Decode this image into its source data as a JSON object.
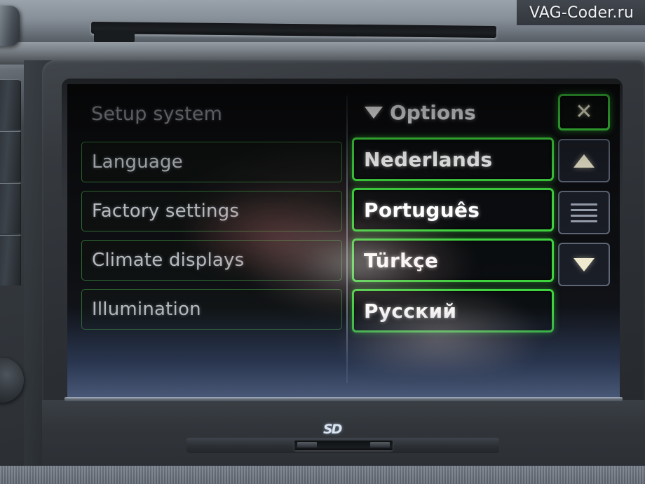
{
  "watermark": {
    "text": "VAG-Coder.ru"
  },
  "device": {
    "sd_slot_label": "SD"
  },
  "screen": {
    "left_panel": {
      "title": "Setup system",
      "items": [
        {
          "label": "Language"
        },
        {
          "label": "Factory settings"
        },
        {
          "label": "Climate displays"
        },
        {
          "label": "Illumination"
        }
      ]
    },
    "options_panel": {
      "header_label": "Options",
      "header_icon": "triangle-down-icon",
      "items": [
        {
          "label": "Nederlands"
        },
        {
          "label": "Português"
        },
        {
          "label": "Türkçe"
        },
        {
          "label": "Русский"
        }
      ]
    },
    "side_buttons": [
      {
        "name": "close-button",
        "icon": "close-x-icon",
        "glyph": "✕"
      },
      {
        "name": "scroll-up-button",
        "icon": "triangle-up-icon"
      },
      {
        "name": "list-button",
        "icon": "list-lines-icon"
      },
      {
        "name": "scroll-down-button",
        "icon": "triangle-down-icon"
      }
    ]
  },
  "colors": {
    "accent_green": "#3fd23f",
    "dim_green": "#2f6b33",
    "menu_text": "#b6babf",
    "title_text": "#8d9197",
    "option_text": "#ffffff",
    "glyph_cream": "#efe9cf"
  }
}
